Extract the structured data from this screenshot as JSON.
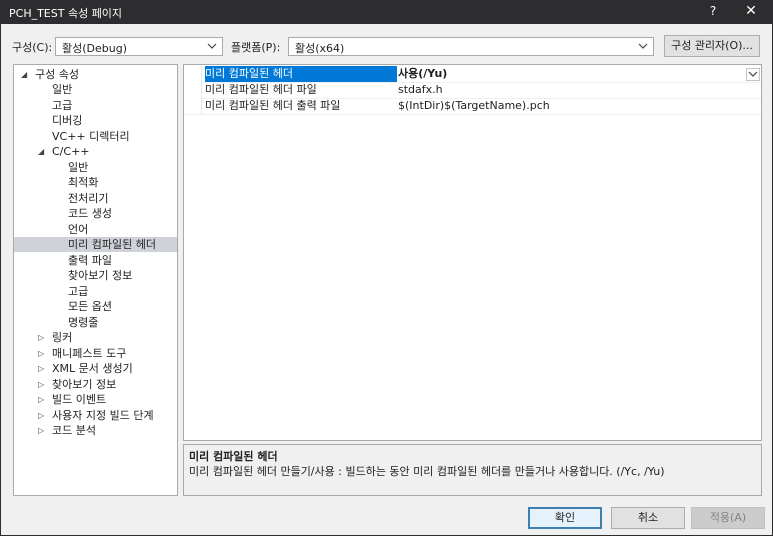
{
  "window": {
    "title": "PCH_TEST 속성 페이지",
    "help": "?",
    "close": "✕"
  },
  "toolbar": {
    "config_label": "구성(C):",
    "config_value": "활성(Debug)",
    "platform_label": "플랫폼(P):",
    "platform_value": "활성(x64)",
    "config_manager": "구성 관리자(O)..."
  },
  "tree": {
    "root": "구성 속성",
    "items": [
      {
        "label": "일반"
      },
      {
        "label": "고급"
      },
      {
        "label": "디버깅"
      },
      {
        "label": "VC++ 디렉터리"
      }
    ],
    "cpp": {
      "label": "C/C++",
      "children": [
        {
          "label": "일반"
        },
        {
          "label": "최적화"
        },
        {
          "label": "전처리기"
        },
        {
          "label": "코드 생성"
        },
        {
          "label": "언어"
        },
        {
          "label": "미리 컴파일된 헤더"
        },
        {
          "label": "출력 파일"
        },
        {
          "label": "찾아보기 정보"
        },
        {
          "label": "고급"
        },
        {
          "label": "모든 옵션"
        },
        {
          "label": "명령줄"
        }
      ]
    },
    "collapsed": [
      {
        "label": "링커"
      },
      {
        "label": "매니페스트 도구"
      },
      {
        "label": "XML 문서 생성기"
      },
      {
        "label": "찾아보기 정보"
      },
      {
        "label": "빌드 이벤트"
      },
      {
        "label": "사용자 지정 빌드 단계"
      },
      {
        "label": "코드 분석"
      }
    ]
  },
  "properties": [
    {
      "name": "미리 컴파일된 헤더",
      "value": "사용(/Yu)"
    },
    {
      "name": "미리 컴파일된 헤더 파일",
      "value": "stdafx.h"
    },
    {
      "name": "미리 컴파일된 헤더 출력 파일",
      "value": "$(IntDir)$(TargetName).pch"
    }
  ],
  "description": {
    "title": "미리 컴파일된 헤더",
    "text": "미리 컴파일된 헤더 만들기/사용 : 빌드하는 동안 미리 컴파일된 헤더를 만들거나 사용합니다.     (/Yc, /Yu)"
  },
  "buttons": {
    "ok": "확인",
    "cancel": "취소",
    "apply": "적용(A)"
  },
  "colors": {
    "selection": "#0078d7",
    "titlebar": "#2d2d30",
    "tree_selection": "#cfd2d9"
  }
}
